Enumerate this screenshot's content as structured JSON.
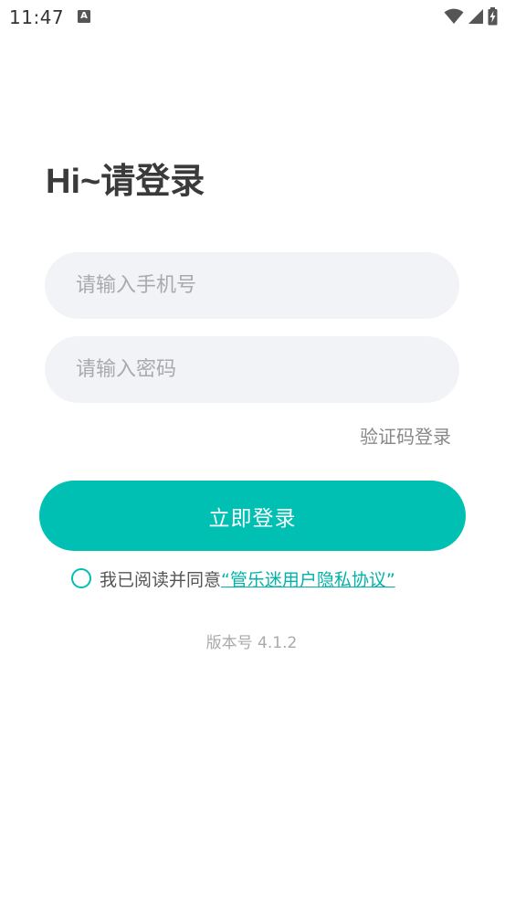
{
  "status_bar": {
    "time": "11:47",
    "notification_icon": "A"
  },
  "login": {
    "title": "Hi~请登录",
    "phone_placeholder": "请输入手机号",
    "password_placeholder": "请输入密码",
    "sms_login_label": "验证码登录",
    "submit_label": "立即登录",
    "agreement_text": "我已阅读并同意",
    "agreement_link": "“管乐迷用户隐私协议”",
    "version": "版本号 4.1.2"
  },
  "colors": {
    "accent": "#00c0b4",
    "field_bg": "#f2f3f7",
    "title": "#3a3a3a"
  }
}
